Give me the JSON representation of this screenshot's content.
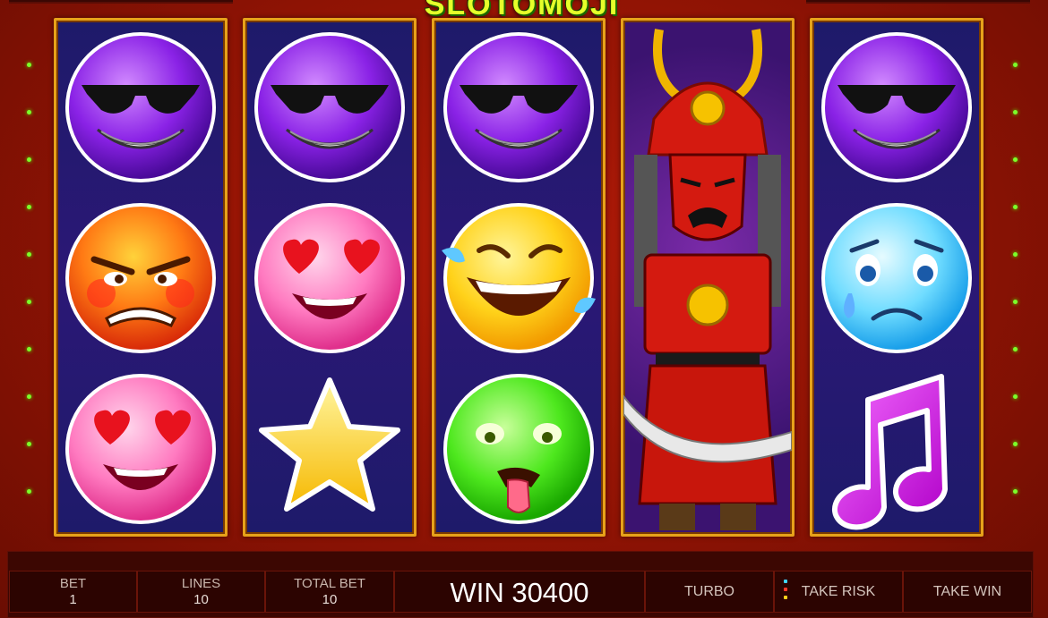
{
  "game": {
    "logo": "SLOTOMOJI"
  },
  "reels": [
    [
      "cool-sunglasses-emoji",
      "angry-emoji",
      "heart-eyes-emoji"
    ],
    [
      "cool-sunglasses-emoji",
      "heart-eyes-emoji",
      "star-symbol"
    ],
    [
      "cool-sunglasses-emoji",
      "laughing-tears-emoji",
      "sick-tongue-emoji"
    ],
    [
      "samurai-wild"
    ],
    [
      "cool-sunglasses-emoji",
      "crying-emoji",
      "music-note-symbol"
    ]
  ],
  "colors": {
    "background": "#8e1304",
    "reel_frame": "#e7a21a",
    "reel_bg": "#2b1876",
    "payline_dot": "#7cff2a"
  },
  "controls": {
    "bet": {
      "label": "BET",
      "value": "1"
    },
    "lines": {
      "label": "LINES",
      "value": "10"
    },
    "total_bet": {
      "label": "TOTAL BET",
      "value": "10"
    },
    "win": {
      "text": "WIN 30400"
    },
    "turbo": {
      "label": "TURBO"
    },
    "take_risk": {
      "label": "TAKE RISK"
    },
    "take_win": {
      "label": "TAKE WIN"
    }
  }
}
